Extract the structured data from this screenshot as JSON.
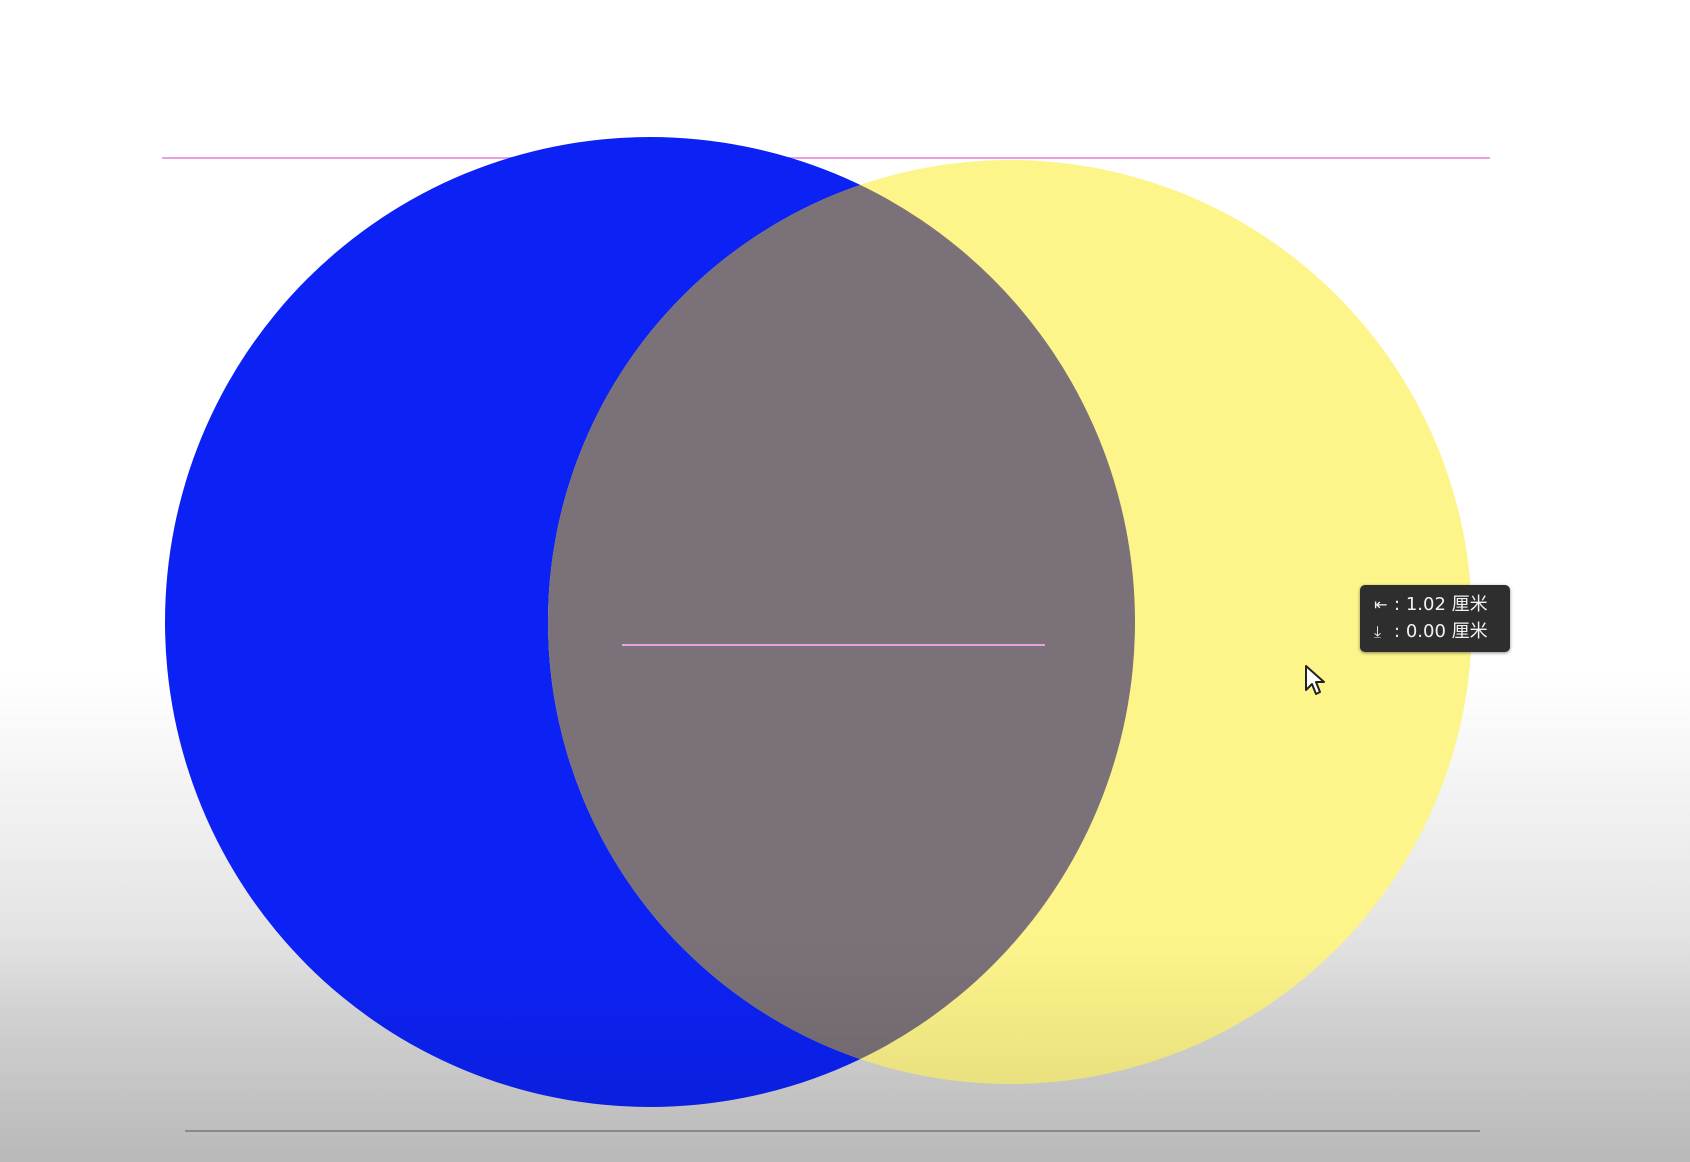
{
  "canvas": {
    "background_color": "#ffffff"
  },
  "shapes": {
    "left_circle": {
      "fill": "#0c22f5"
    },
    "right_circle": {
      "fill": "#fdf48a"
    },
    "intersection": {
      "fill": "#7b7178"
    },
    "guide_color": "#e8a0e0"
  },
  "tooltip": {
    "horizontal_icon": "arrow-to-left-icon",
    "horizontal_value": "1.02 厘米",
    "vertical_icon": "arrow-to-bottom-icon",
    "vertical_value": "0.00 厘米",
    "separator": ":"
  },
  "cursor": {
    "icon": "mouse-pointer-icon"
  }
}
